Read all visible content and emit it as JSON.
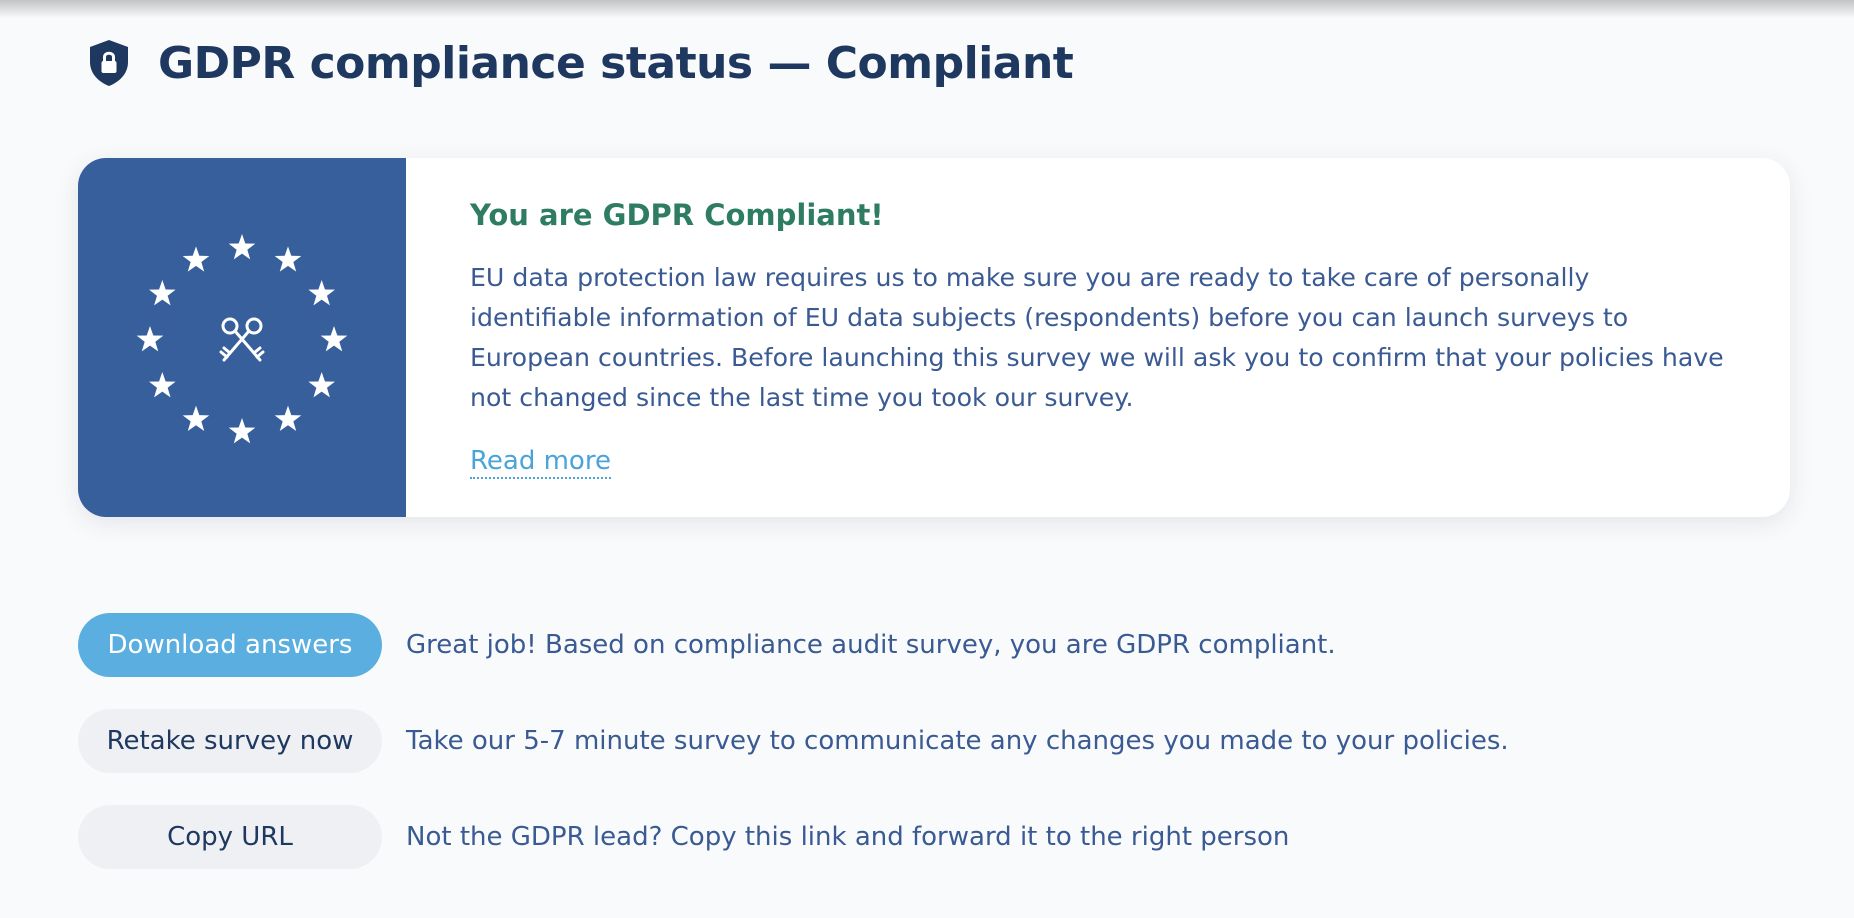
{
  "header": {
    "title": "GDPR compliance status — Compliant",
    "icon": "shield-lock-icon"
  },
  "card": {
    "flag_icon": "eu-flag-keys-icon",
    "heading": "You are GDPR Compliant!",
    "body": "EU data protection law requires us to make sure you are ready to take care of personally identifiable information of EU data subjects (respondents) before you can launch surveys to European countries. Before launching this survey we will ask you to confirm that your policies have not changed since the last time you took our survey.",
    "read_more": "Read more"
  },
  "actions": [
    {
      "button": "Download answers",
      "description": "Great job! Based on compliance audit survey, you are GDPR compliant."
    },
    {
      "button": "Retake survey now",
      "description": "Take our 5-7 minute survey to communicate any changes you made to your policies."
    },
    {
      "button": "Copy URL",
      "description": "Not the GDPR lead? Copy this link and forward it to the right person"
    }
  ],
  "colors": {
    "title": "#1f3860",
    "text": "#3a5a93",
    "heading_green": "#2e7d62",
    "flag_blue": "#365f9c",
    "primary_button": "#5aaee0",
    "secondary_button": "#eef0f3",
    "link": "#4aa3d9"
  }
}
